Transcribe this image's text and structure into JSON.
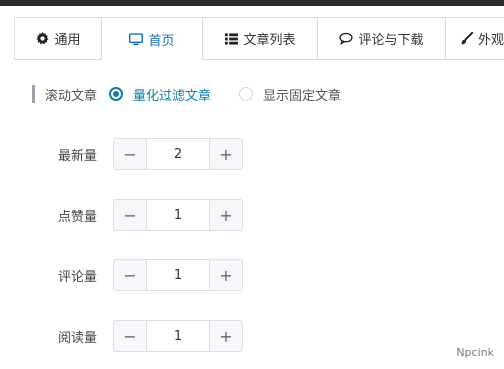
{
  "tabs": [
    {
      "label": "通用",
      "icon": "gear-icon",
      "active": false
    },
    {
      "label": "首页",
      "icon": "monitor-icon",
      "active": true
    },
    {
      "label": "文章列表",
      "icon": "list-icon",
      "active": false
    },
    {
      "label": "评论与下载",
      "icon": "comment-icon",
      "active": false
    },
    {
      "label": "外观设",
      "icon": "brush-icon",
      "active": false
    }
  ],
  "scroll_section": {
    "label": "滚动文章",
    "options": [
      {
        "label": "量化过滤文章",
        "selected": true
      },
      {
        "label": "显示固定文章",
        "selected": false
      }
    ]
  },
  "fields": [
    {
      "label": "最新量",
      "value": "2"
    },
    {
      "label": "点赞量",
      "value": "1"
    },
    {
      "label": "评论量",
      "value": "1"
    },
    {
      "label": "阅读量",
      "value": "1"
    }
  ],
  "stepper": {
    "minus": "−",
    "plus": "+"
  },
  "watermark": "Npcink",
  "colors": {
    "accent": "#0f7ea3",
    "tab_active": "#1a6fb0",
    "border": "#dcdcdc"
  }
}
